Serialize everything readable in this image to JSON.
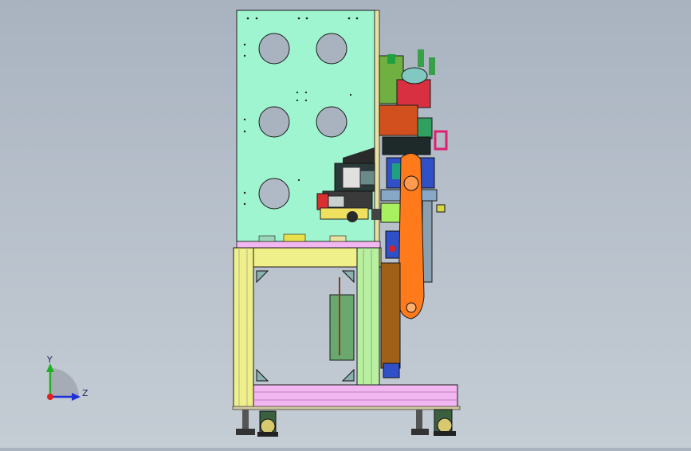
{
  "viewport": {
    "background_top": "#a9b3c0",
    "background_bottom": "#c4ccd4"
  },
  "triad": {
    "y_label": "Y",
    "z_label": "Z",
    "x_color": "#e02020",
    "y_color": "#22b022",
    "z_color": "#2030d8"
  },
  "colors": {
    "cabinet_panel": "#9ff5cf",
    "frame_yellow": "#f0f08a",
    "frame_green": "#b8f0a0",
    "base_pink": "#f2b6f0",
    "orange_arm": "#ff7a1a",
    "brown_block": "#d2501e",
    "outline": "#1a1a1a"
  },
  "icons": [
    "coordinate-triad-icon"
  ]
}
